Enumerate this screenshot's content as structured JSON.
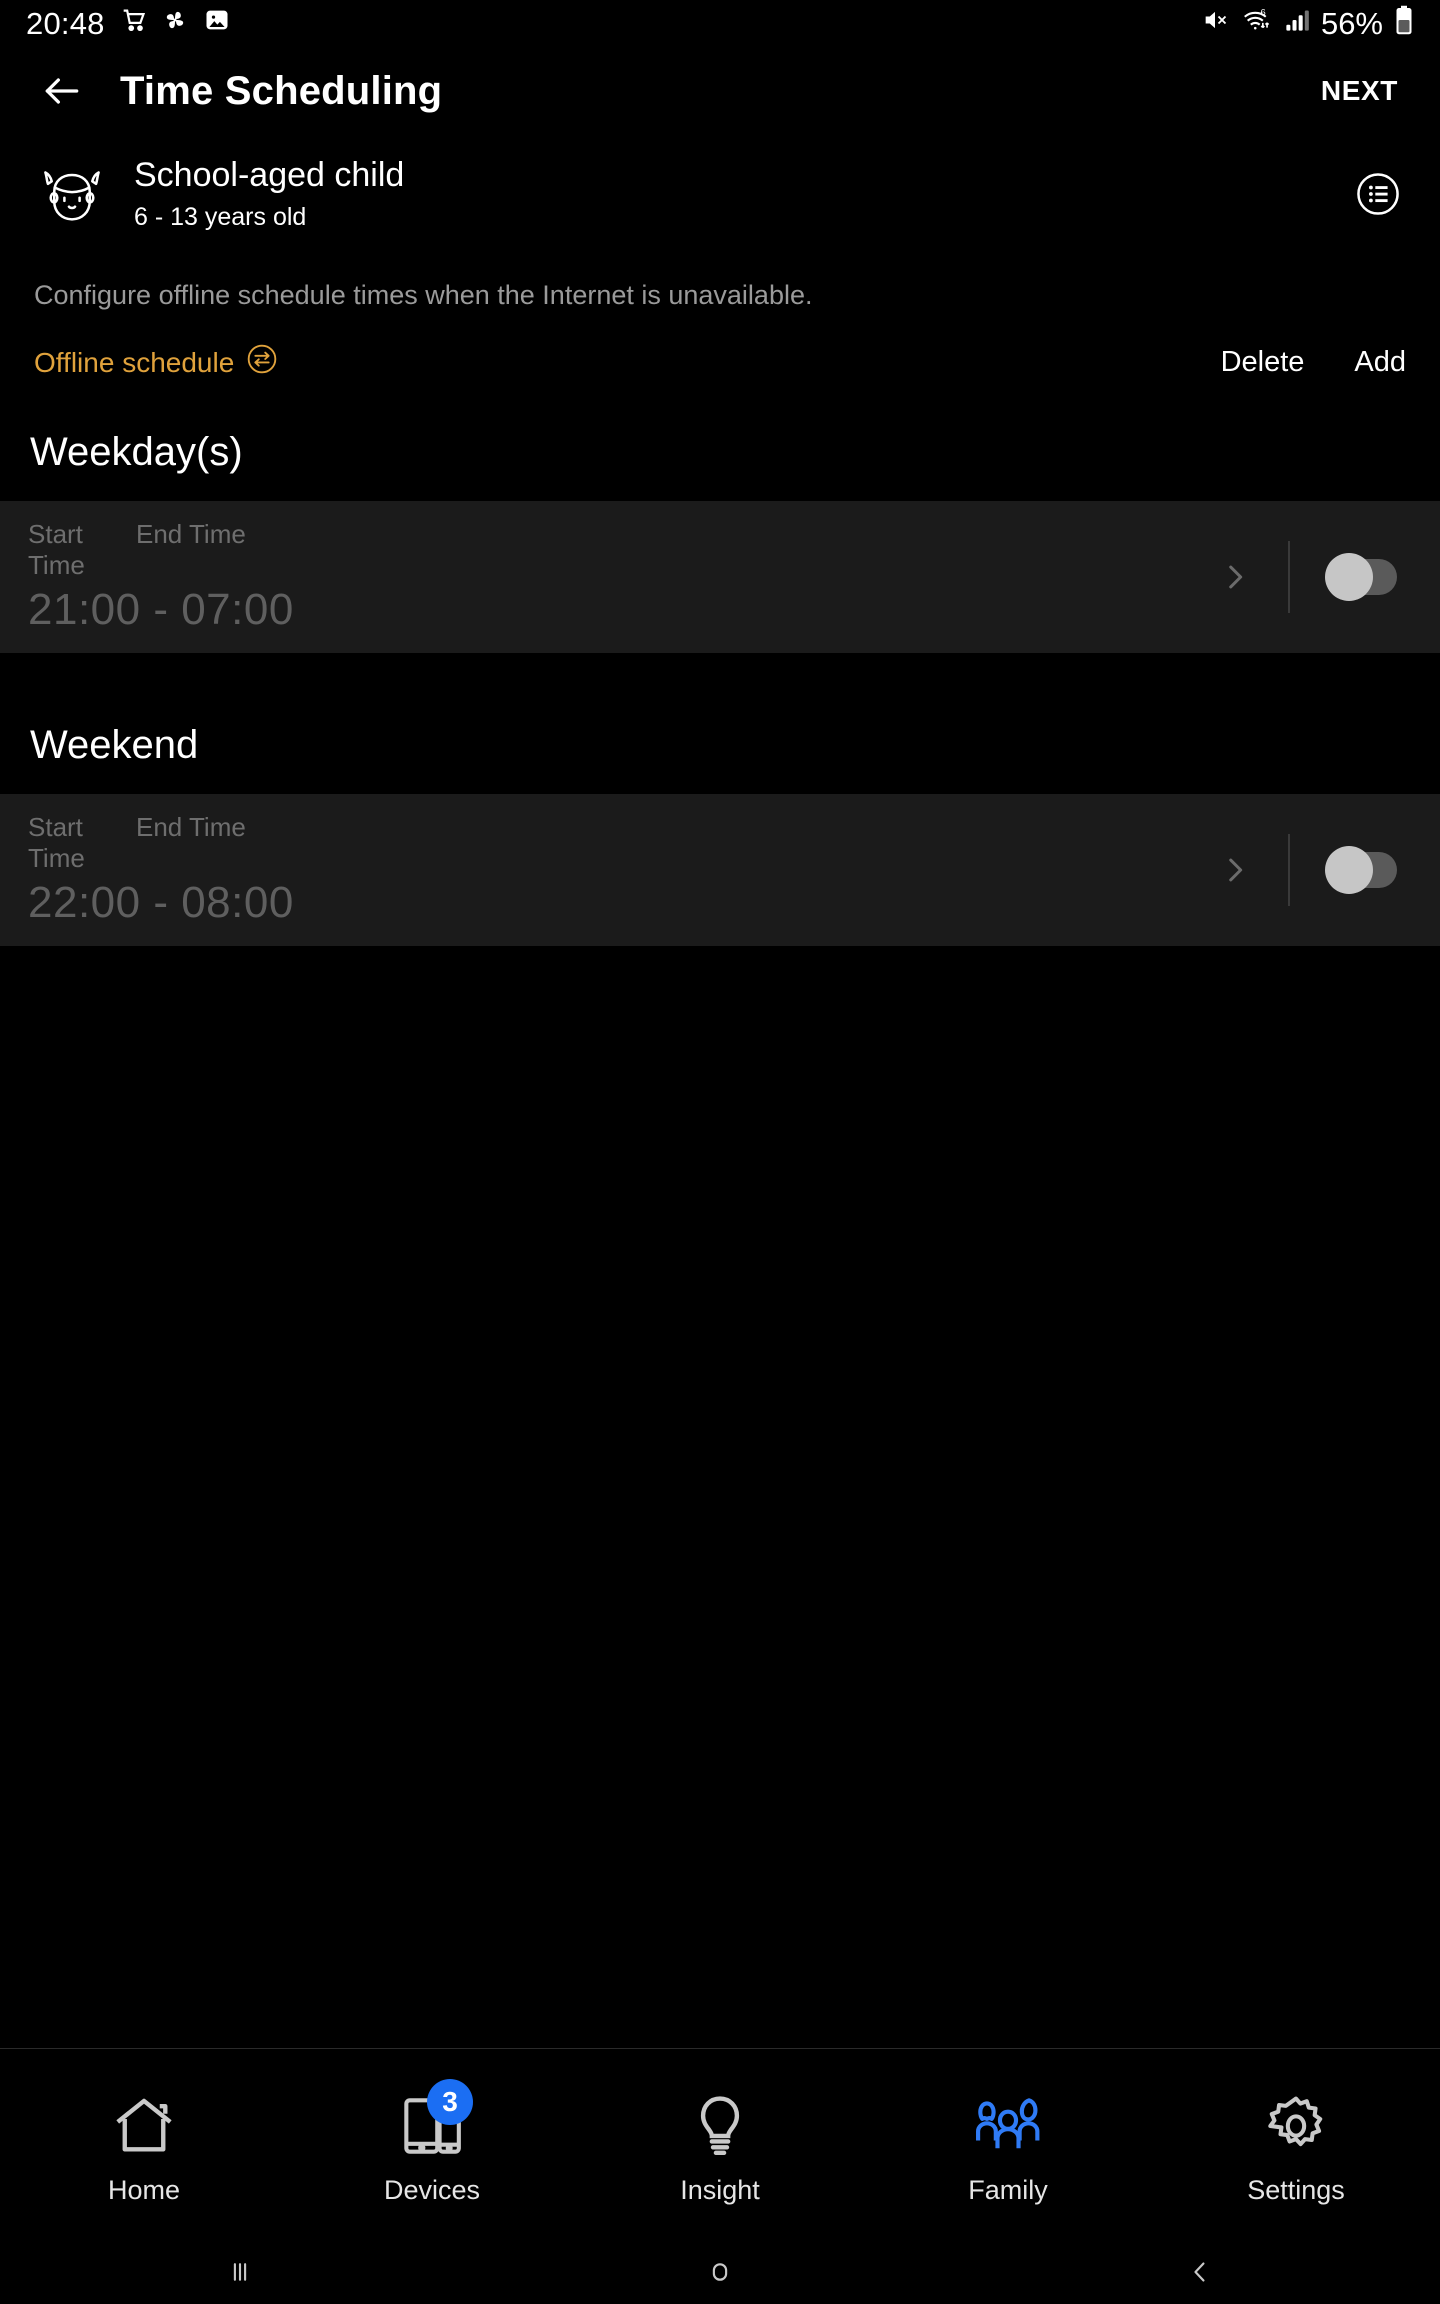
{
  "status_bar": {
    "time": "20:48",
    "icons_left": [
      "shopping-cart-icon",
      "pinwheel-icon",
      "gallery-icon"
    ],
    "icons_right": [
      "mute-icon",
      "wifi6-icon",
      "signal-icon"
    ],
    "battery_percent": "56%"
  },
  "app_bar": {
    "back": "back-arrow-icon",
    "title": "Time Scheduling",
    "next_label": "NEXT"
  },
  "profile": {
    "avatar": "child-face-icon",
    "name": "School-aged child",
    "age_range": "6 - 13 years old",
    "menu_icon": "list-circle-icon"
  },
  "description": "Configure offline schedule times when the Internet is unavailable.",
  "offline": {
    "label": "Offline schedule",
    "icon": "swap-arrows-circle-icon",
    "color": "#E0A23C",
    "delete_label": "Delete",
    "add_label": "Add"
  },
  "sections": [
    {
      "title": "Weekday(s)",
      "start_label": "Start Time",
      "end_label": "End Time",
      "time_range": "21:00 - 07:00",
      "enabled": false
    },
    {
      "title": "Weekend",
      "start_label": "Start Time",
      "end_label": "End Time",
      "time_range": "22:00 - 08:00",
      "enabled": false
    }
  ],
  "bottom_nav": {
    "active_color": "#2f7bf6",
    "items": [
      {
        "label": "Home",
        "icon": "home-icon",
        "badge": "",
        "active": false
      },
      {
        "label": "Devices",
        "icon": "devices-icon",
        "badge": "3",
        "active": false
      },
      {
        "label": "Insight",
        "icon": "bulb-icon",
        "badge": "",
        "active": false
      },
      {
        "label": "Family",
        "icon": "family-icon",
        "badge": "",
        "active": true
      },
      {
        "label": "Settings",
        "icon": "gear-icon",
        "badge": "",
        "active": false
      }
    ]
  },
  "android_nav": {
    "recents": "recents-icon",
    "home": "home-circle-icon",
    "back": "back-chevron-icon"
  }
}
